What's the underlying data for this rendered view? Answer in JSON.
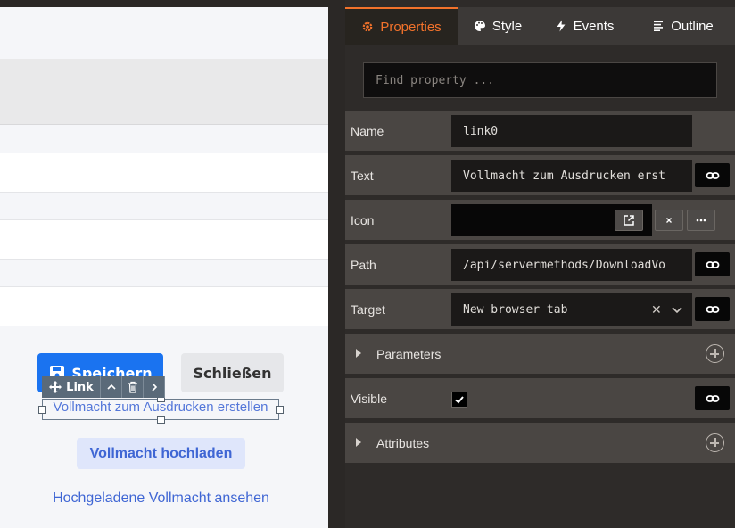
{
  "canvas": {
    "save_label": "Speichern",
    "close_label": "Schließen",
    "toolbar_label": "Link",
    "link_text": "Vollmacht zum Ausdrucken erstellen",
    "upload_label": "Vollmacht hochladen",
    "view_label": "Hochgeladene Vollmacht ansehen"
  },
  "tabs": [
    {
      "label": "Properties",
      "icon": "gear-icon"
    },
    {
      "label": "Style",
      "icon": "palette-icon"
    },
    {
      "label": "Events",
      "icon": "bolt-icon"
    },
    {
      "label": "Outline",
      "icon": "list-icon"
    }
  ],
  "search": {
    "placeholder": "Find property ..."
  },
  "properties": {
    "name": {
      "label": "Name",
      "value": "link0"
    },
    "text": {
      "label": "Text",
      "value": "Vollmacht zum Ausdrucken erst"
    },
    "icon": {
      "label": "Icon",
      "value": ""
    },
    "path": {
      "label": "Path",
      "value": "/api/servermethods/DownloadVo"
    },
    "target": {
      "label": "Target",
      "value": "New browser tab"
    },
    "parameters": {
      "label": "Parameters"
    },
    "visible": {
      "label": "Visible",
      "checked": true
    },
    "attributes": {
      "label": "Attributes"
    }
  },
  "colors": {
    "accent": "#f2722b",
    "primary": "#1a73f0",
    "link": "#5477d9"
  }
}
